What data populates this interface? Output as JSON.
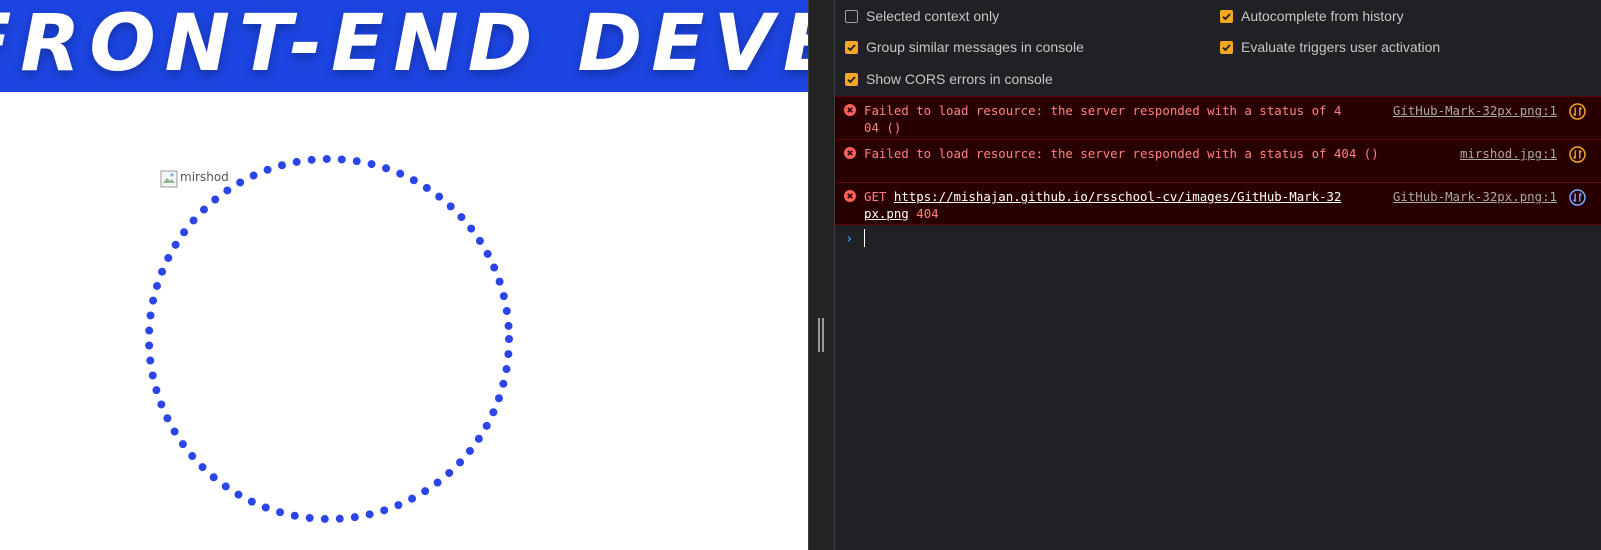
{
  "page": {
    "banner_text": "FRONT-END DEVELOPER",
    "avatar_alt": "mirshod",
    "banner_color": "#1c44e0",
    "ring_color": "#2b45e8"
  },
  "console_settings": [
    {
      "label": "Selected context only",
      "checked": false
    },
    {
      "label": "Autocomplete from history",
      "checked": true
    },
    {
      "label": "Group similar messages in console",
      "checked": true
    },
    {
      "label": "Evaluate triggers user activation",
      "checked": true
    },
    {
      "label": "Show CORS errors in console",
      "checked": true
    }
  ],
  "messages": [
    {
      "text": "Failed to load resource: the server responded with a status of 404 ()",
      "source": "GitHub-Mark-32px.png:1",
      "action_icon": "network-request-icon"
    },
    {
      "text": "Failed to load resource: the server responded with a status of 404 ()",
      "source": "mirshod.jpg:1",
      "action_icon": "network-request-icon"
    },
    {
      "method": "GET",
      "url": "https://mishajan.github.io/rsschool-cv/images/GitHub-Mark-32px.png",
      "status": "404",
      "source": "GitHub-Mark-32px.png:1",
      "action_icon": "network-request-icon"
    }
  ],
  "prompt": {
    "chevron": "›",
    "value": ""
  },
  "colors": {
    "devtools_bg": "#202124",
    "error_bg": "#290000",
    "error_text": "#ff8080",
    "checkbox_on": "#f5a623",
    "prompt_chevron": "#3e8fe8"
  }
}
